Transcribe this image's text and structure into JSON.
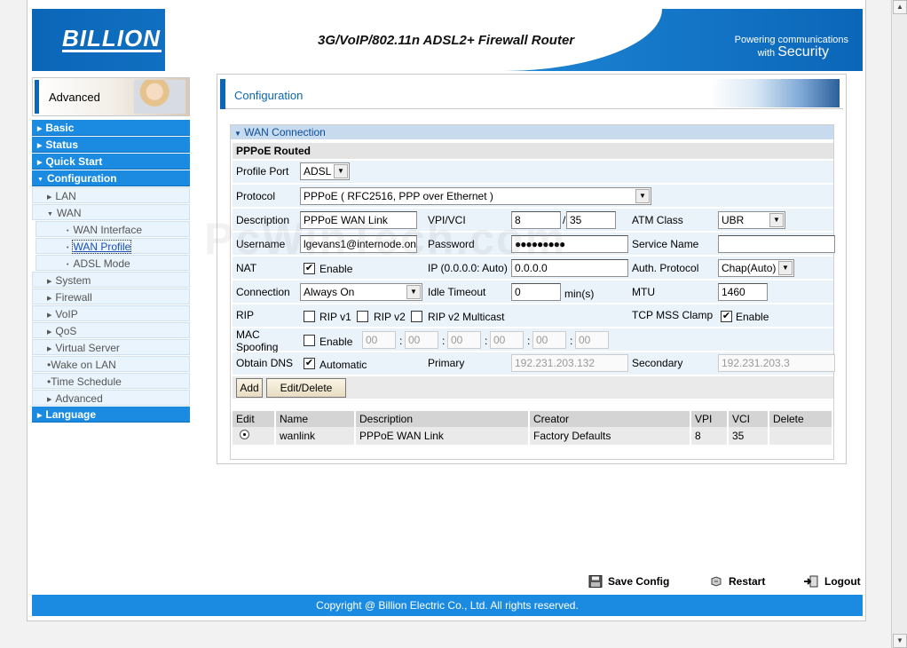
{
  "header": {
    "logo": "BILLION",
    "product_title": "3G/VoIP/802.11n ADSL2+ Firewall Router",
    "tagline_line1": "Powering communications",
    "tagline_line2_prefix": "with",
    "tagline_line2_word": "Security"
  },
  "sidebar": {
    "mode_label": "Advanced",
    "items": [
      {
        "label": "Basic"
      },
      {
        "label": "Status"
      },
      {
        "label": "Quick Start"
      },
      {
        "label": "Configuration"
      },
      {
        "label": "LAN"
      },
      {
        "label": "WAN"
      },
      {
        "label": "WAN Interface"
      },
      {
        "label": "WAN Profile"
      },
      {
        "label": "ADSL Mode"
      },
      {
        "label": "System"
      },
      {
        "label": "Firewall"
      },
      {
        "label": "VoIP"
      },
      {
        "label": "QoS"
      },
      {
        "label": "Virtual Server"
      },
      {
        "label": "Wake on LAN"
      },
      {
        "label": "Time Schedule"
      },
      {
        "label": "Advanced"
      },
      {
        "label": "Language"
      }
    ]
  },
  "main": {
    "page_title": "Configuration",
    "panel_title": "WAN Connection",
    "section_title": "PPPoE Routed",
    "labels": {
      "profile_port": "Profile Port",
      "protocol": "Protocol",
      "description": "Description",
      "vpi_vci": "VPI/VCI",
      "atm_class": "ATM Class",
      "username": "Username",
      "password": "Password",
      "service_name": "Service Name",
      "nat": "NAT",
      "ip": "IP (0.0.0.0: Auto)",
      "auth_protocol": "Auth. Protocol",
      "connection": "Connection",
      "idle_timeout": "Idle Timeout",
      "min_unit": "min(s)",
      "mtu": "MTU",
      "rip": "RIP",
      "tcp_mss_clamp": "TCP MSS Clamp",
      "mac_spoofing_1": "MAC",
      "mac_spoofing_2": "Spoofing",
      "obtain_dns": "Obtain DNS",
      "primary": "Primary",
      "secondary": "Secondary",
      "enable": "Enable",
      "automatic": "Automatic",
      "rip_v1": "RIP v1",
      "rip_v2": "RIP v2",
      "rip_v2_multicast": "RIP v2 Multicast"
    },
    "values": {
      "profile_port": "ADSL",
      "protocol": "PPPoE ( RFC2516, PPP over Ethernet )",
      "description": "PPPoE WAN Link",
      "vpi": "8",
      "vci": "35",
      "atm_class": "UBR",
      "username": "lgevans1@internode.on",
      "password": "●●●●●●●●●",
      "service_name": "",
      "ip": "0.0.0.0",
      "auth_protocol": "Chap(Auto)",
      "connection": "Always On",
      "idle_timeout": "0",
      "mtu": "1460",
      "mac_octet": "00",
      "primary_dns": "192.231.203.132",
      "secondary_dns": "192.231.203.3",
      "nat_checked": "✔",
      "tcp_mss_checked": "✔",
      "dns_auto_checked": "✔"
    },
    "buttons": {
      "add": "Add",
      "edit_delete": "Edit/Delete"
    },
    "table": {
      "headers": [
        "Edit",
        "Name",
        "Description",
        "Creator",
        "VPI",
        "VCI",
        "Delete"
      ],
      "rows": [
        {
          "name": "wanlink",
          "description": "PPPoE WAN Link",
          "creator": "Factory Defaults",
          "vpi": "8",
          "vci": "35",
          "delete": ""
        }
      ]
    }
  },
  "bottom": {
    "save": "Save Config",
    "restart": "Restart",
    "logout": "Logout"
  },
  "footer": {
    "copyright": "Copyright @ Billion Electric Co., Ltd. All rights reserved."
  },
  "watermark": "PcWinTech.com",
  "icons": {
    "scroll_up": "▲",
    "scroll_down": "▼",
    "triangle_right": "▶",
    "triangle_down": "▼",
    "dot": "•"
  }
}
